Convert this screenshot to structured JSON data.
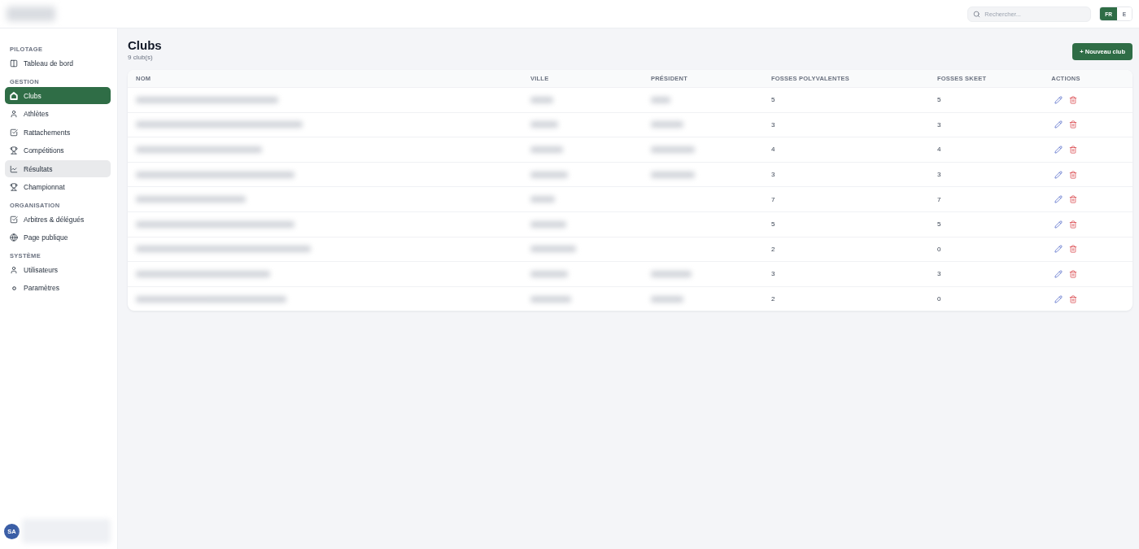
{
  "header": {
    "search": {
      "placeholder": "Rechercher..."
    },
    "languages": [
      {
        "label": "FR",
        "selected": true
      },
      {
        "label": "E",
        "selected": false
      }
    ]
  },
  "sidebar": {
    "sections": [
      {
        "title": "PILOTAGE",
        "items": [
          {
            "label": "Tableau de bord",
            "selected": false,
            "hovered": false
          }
        ]
      },
      {
        "title": "GESTION",
        "items": [
          {
            "label": "Clubs",
            "selected": true,
            "hovered": false
          },
          {
            "label": "Athlètes",
            "selected": false,
            "hovered": false
          },
          {
            "label": "Rattachements",
            "selected": false,
            "hovered": false
          },
          {
            "label": "Compétitions",
            "selected": false,
            "hovered": false
          },
          {
            "label": "Résultats",
            "selected": false,
            "hovered": true
          },
          {
            "label": "Championnat",
            "selected": false,
            "hovered": false
          }
        ]
      },
      {
        "title": "ORGANISATION",
        "items": [
          {
            "label": "Arbitres & délégués",
            "selected": false,
            "hovered": false
          },
          {
            "label": "Page publique",
            "selected": false,
            "hovered": false
          }
        ]
      },
      {
        "title": "SYSTÈME",
        "items": [
          {
            "label": "Utilisateurs",
            "selected": false,
            "hovered": false
          },
          {
            "label": "Paramètres",
            "selected": false,
            "hovered": false
          }
        ]
      }
    ],
    "user": {
      "initials": "SA"
    }
  },
  "page": {
    "title": "Clubs",
    "subtitle": "9 club(s)",
    "action": "+ Nouveau club"
  },
  "table": {
    "columns": [
      "NOM",
      "VILLE",
      "PRÉSIDENT",
      "FOSSES POLYVALENTES",
      "FOSSES SKEET",
      "ACTIONS"
    ],
    "rows": [
      {
        "has_president": true,
        "fosses_polyvalentes": "5",
        "fosses_skeet": "5"
      },
      {
        "has_president": true,
        "fosses_polyvalentes": "3",
        "fosses_skeet": "3"
      },
      {
        "has_president": true,
        "fosses_polyvalentes": "4",
        "fosses_skeet": "4"
      },
      {
        "has_president": true,
        "fosses_polyvalentes": "3",
        "fosses_skeet": "3"
      },
      {
        "has_president": false,
        "fosses_polyvalentes": "7",
        "fosses_skeet": "7"
      },
      {
        "has_president": false,
        "fosses_polyvalentes": "5",
        "fosses_skeet": "5"
      },
      {
        "has_president": false,
        "fosses_polyvalentes": "2",
        "fosses_skeet": "0"
      },
      {
        "has_president": true,
        "fosses_polyvalentes": "3",
        "fosses_skeet": "3"
      },
      {
        "has_president": true,
        "fosses_polyvalentes": "2",
        "fosses_skeet": "0"
      }
    ]
  }
}
